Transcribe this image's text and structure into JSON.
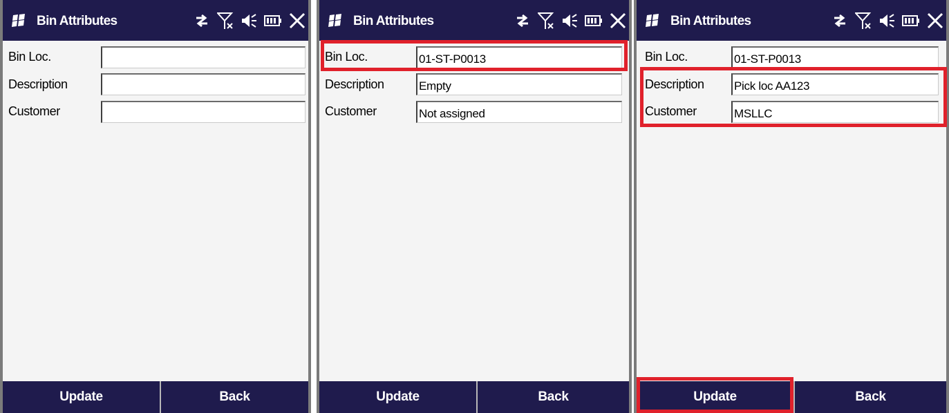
{
  "colors": {
    "titlebar": "#1f1b4d",
    "highlight": "#e0212b",
    "background": "#f4f4f4"
  },
  "icons": [
    "windows-start-icon",
    "sync-arrows-icon",
    "signal-off-icon",
    "speaker-icon",
    "battery-icon",
    "close-icon"
  ],
  "screens": [
    {
      "title": "Bin Attributes",
      "fields": [
        {
          "label": "Bin Loc.",
          "value": ""
        },
        {
          "label": "Description",
          "value": ""
        },
        {
          "label": "Customer",
          "value": ""
        }
      ],
      "softkeys": {
        "left": "Update",
        "right": "Back"
      }
    },
    {
      "title": "Bin Attributes",
      "fields": [
        {
          "label": "Bin Loc.",
          "value": "01-ST-P0013"
        },
        {
          "label": "Description",
          "value": "Empty"
        },
        {
          "label": "Customer",
          "value": "Not assigned"
        }
      ],
      "softkeys": {
        "left": "Update",
        "right": "Back"
      }
    },
    {
      "title": "Bin Attributes",
      "fields": [
        {
          "label": "Bin Loc.",
          "value": "01-ST-P0013"
        },
        {
          "label": "Description",
          "value": "Pick loc AA123"
        },
        {
          "label": "Customer",
          "value": "MSLLC"
        }
      ],
      "softkeys": {
        "left": "Update",
        "right": "Back"
      }
    }
  ]
}
